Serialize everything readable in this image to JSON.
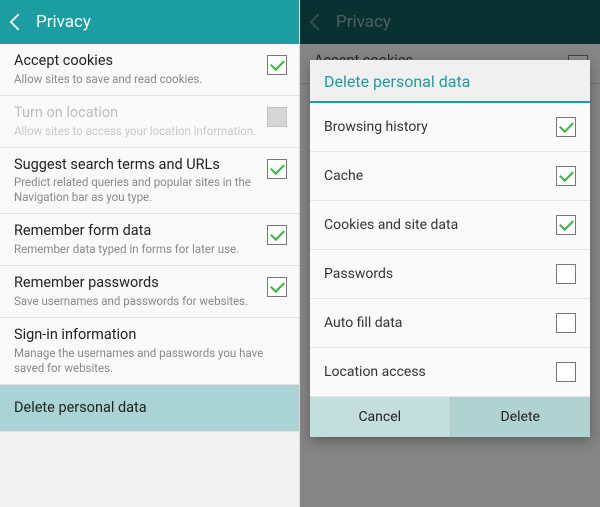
{
  "left": {
    "header": "Privacy",
    "items": [
      {
        "title": "Accept cookies",
        "sub": "Allow sites to save and read cookies.",
        "checked": true,
        "disabled": false
      },
      {
        "title": "Turn on location",
        "sub": "Allow sites to access your location information.",
        "checked": false,
        "disabled": true
      },
      {
        "title": "Suggest search terms and URLs",
        "sub": "Predict related queries and popular sites in the Navigation bar as you type.",
        "checked": true,
        "disabled": false
      },
      {
        "title": "Remember form data",
        "sub": "Remember data typed in forms for later use.",
        "checked": true,
        "disabled": false
      },
      {
        "title": "Remember passwords",
        "sub": "Save usernames and passwords for websites.",
        "checked": true,
        "disabled": false
      },
      {
        "title": "Sign-in information",
        "sub": "Manage the usernames and passwords you have saved for websites.",
        "checked": null,
        "disabled": false
      }
    ],
    "delete_row": "Delete personal data"
  },
  "right": {
    "header": "Privacy",
    "bg_item_title": "Accept cookies",
    "dialog": {
      "title": "Delete personal data",
      "items": [
        {
          "label": "Browsing history",
          "checked": true
        },
        {
          "label": "Cache",
          "checked": true
        },
        {
          "label": "Cookies and site data",
          "checked": true
        },
        {
          "label": "Passwords",
          "checked": false
        },
        {
          "label": "Auto fill data",
          "checked": false
        },
        {
          "label": "Location access",
          "checked": false
        }
      ],
      "cancel": "Cancel",
      "delete": "Delete"
    }
  }
}
